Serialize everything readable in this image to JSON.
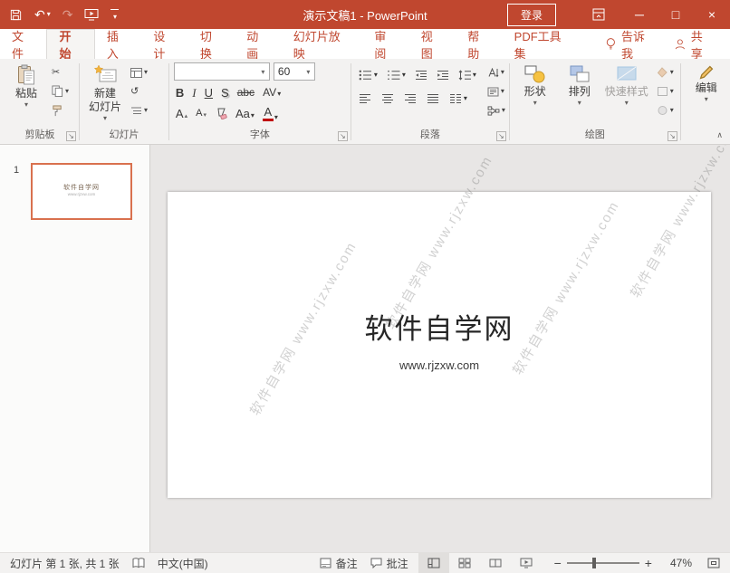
{
  "colors": {
    "accent": "#C0472F",
    "titlebar_bg": "#C0472F",
    "ribbon_bg": "#F3F2F1",
    "statusbar_bg": "#F3F2F1",
    "canvas_bg": "#E8E6E5",
    "thumb_selected_border": "#D9714E"
  },
  "icons": {
    "caret_down": "▾",
    "caret_up": "▴",
    "undo": "↶",
    "redo": "↷",
    "cut": "✂",
    "reset_slide": "↺",
    "minimize": "─",
    "maximize": "□",
    "close": "×",
    "zoom_out": "−",
    "zoom_in": "+",
    "collapse_ribbon": "∧",
    "launcher": "↘"
  },
  "titlebar": {
    "title": "演示文稿1 - PowerPoint",
    "sign_in": "登录"
  },
  "tabs": {
    "items": [
      "文件",
      "开始",
      "插入",
      "设计",
      "切换",
      "动画",
      "幻灯片放映",
      "审阅",
      "视图",
      "帮助",
      "PDF工具集"
    ],
    "selected": "开始",
    "tell_me": "告诉我",
    "share": "共享"
  },
  "ribbon": {
    "clipboard": {
      "label": "剪贴板",
      "paste": "粘贴"
    },
    "slides": {
      "label": "幻灯片",
      "new_slide_line1": "新建",
      "new_slide_line2": "幻灯片"
    },
    "font": {
      "label": "字体",
      "font_name_value": "",
      "font_size_value": "60",
      "bold": "B",
      "italic": "I",
      "underline": "U",
      "shadow": "S",
      "strikethrough": "abc",
      "char_spacing": "AV",
      "change_case": "Aa",
      "grow_font": "A",
      "shrink_font": "A",
      "font_color": "A"
    },
    "paragraph": {
      "label": "段落"
    },
    "drawing": {
      "label": "绘图",
      "shapes": "形状",
      "arrange": "排列",
      "quick_styles": "快速样式"
    },
    "editing": {
      "label": "编辑"
    }
  },
  "thumbnail_panel": {
    "slide_number": "1",
    "thumb_title": "软件自学网",
    "thumb_subtitle": "www.rjzxw.com"
  },
  "slide": {
    "title": "软件自学网",
    "subtitle": "www.rjzxw.com",
    "watermark": "软件自学网 www.rjzxw.com"
  },
  "statusbar": {
    "slide_info": "幻灯片 第 1 张, 共 1 张",
    "language": "中文(中国)",
    "notes": "备注",
    "comments": "批注",
    "zoom_level": "47%"
  }
}
